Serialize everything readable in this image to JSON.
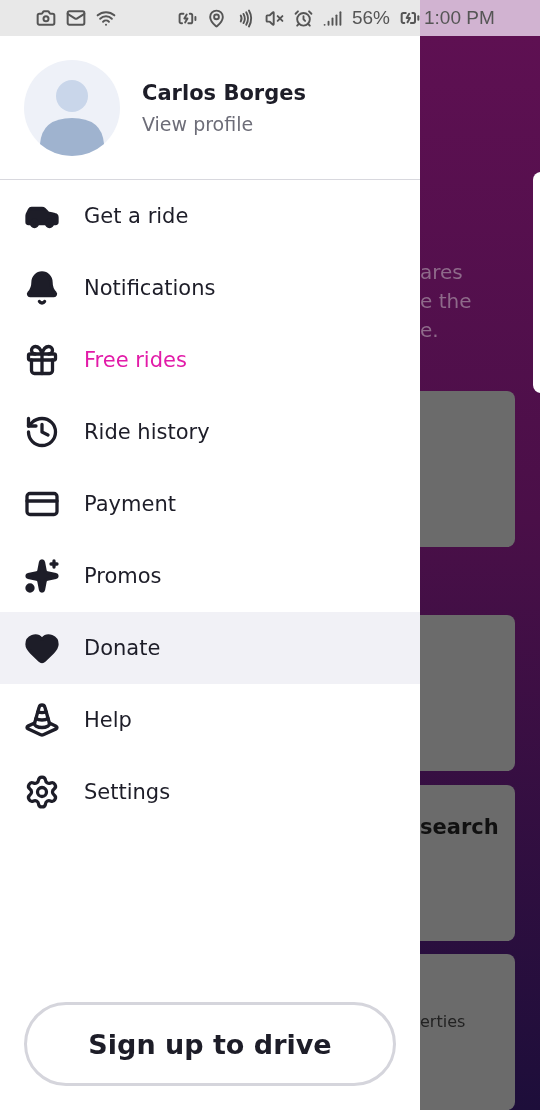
{
  "status_bar": {
    "battery": "56%",
    "time": "1:00 PM"
  },
  "profile": {
    "name": "Carlos Borges",
    "link": "View profile"
  },
  "menu": [
    {
      "label": "Get a ride",
      "highlighted": false,
      "selected": false
    },
    {
      "label": "Notifications",
      "highlighted": false,
      "selected": false
    },
    {
      "label": "Free rides",
      "highlighted": true,
      "selected": false
    },
    {
      "label": "Ride history",
      "highlighted": false,
      "selected": false
    },
    {
      "label": "Payment",
      "highlighted": false,
      "selected": false
    },
    {
      "label": "Promos",
      "highlighted": false,
      "selected": false
    },
    {
      "label": "Donate",
      "highlighted": false,
      "selected": true
    },
    {
      "label": "Help",
      "highlighted": false,
      "selected": false
    },
    {
      "label": "Settings",
      "highlighted": false,
      "selected": false
    }
  ],
  "drive_button": "Sign up to drive",
  "background": {
    "caption": [
      "ares",
      "e the",
      "e."
    ],
    "cards": [
      {
        "kind": "blank"
      },
      {
        "kind": "blank"
      },
      {
        "kind": "titled",
        "text": "search"
      },
      {
        "kind": "subtitled",
        "text": "erties"
      }
    ]
  }
}
